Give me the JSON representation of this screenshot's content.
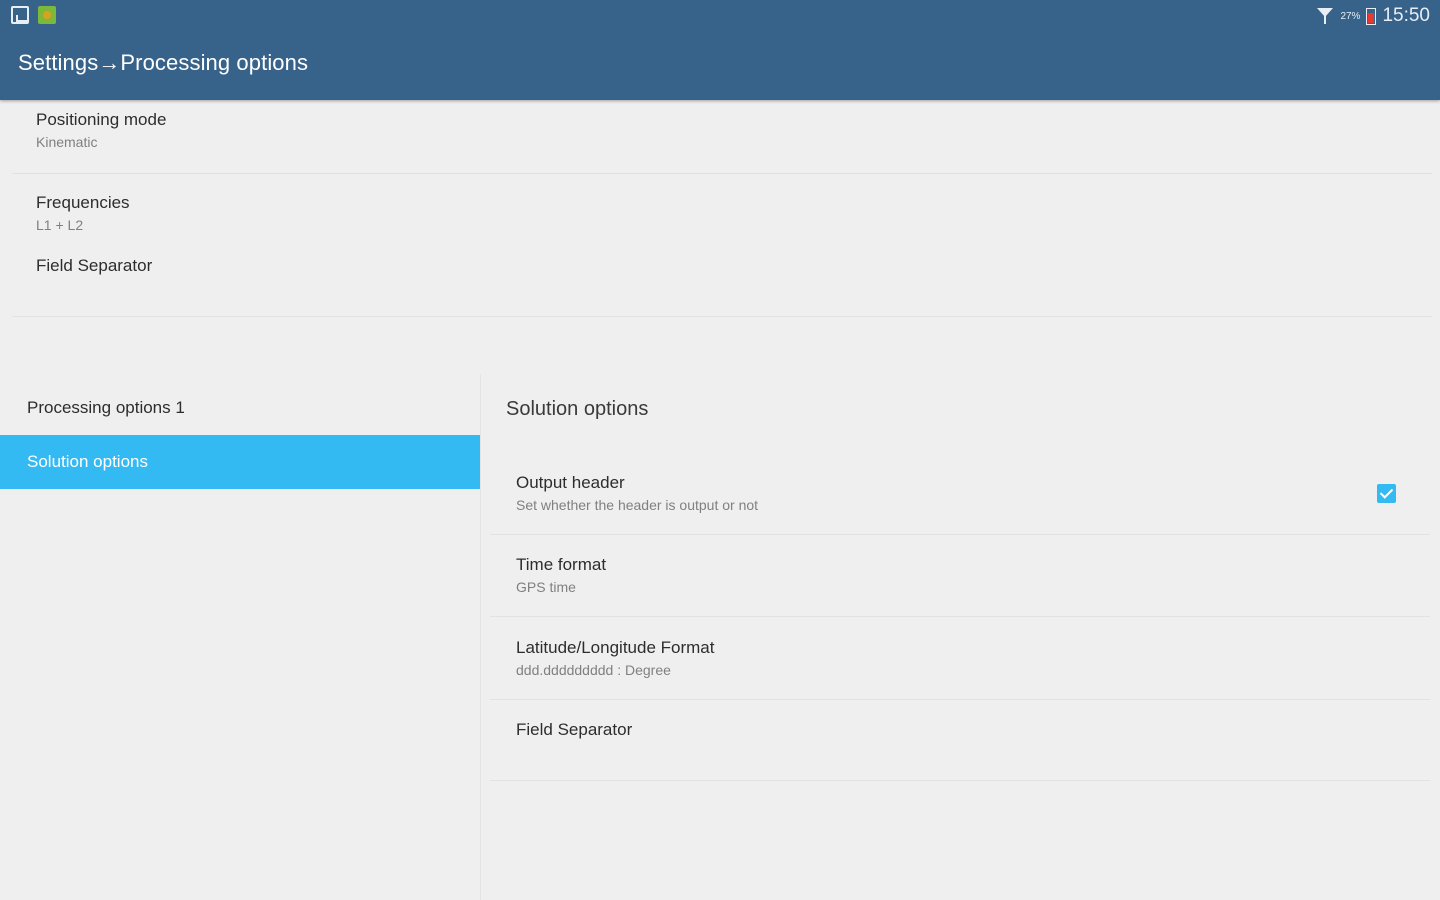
{
  "status_bar": {
    "battery": "27%",
    "time": "15:50",
    "icons": [
      "gallery-notification-icon",
      "app-notification-icon",
      "wifi-icon",
      "battery-icon"
    ]
  },
  "header": {
    "title": "Settings→Processing options"
  },
  "top_prefs": [
    {
      "title": "Positioning mode",
      "summary": "Kinematic"
    },
    {
      "title": "Frequencies",
      "summary": "L1 + L2"
    },
    {
      "title": "Field Separator",
      "summary": ""
    }
  ],
  "sidebar": {
    "items": [
      {
        "label": "Processing options 1",
        "selected": false
      },
      {
        "label": "Solution options",
        "selected": true
      }
    ]
  },
  "solution_options": {
    "title": "Solution options",
    "items": [
      {
        "title": "Output header",
        "summary": "Set whether the header is output or not",
        "checked": true
      },
      {
        "title": "Time format",
        "summary": "GPS time"
      },
      {
        "title": "Latitude/Longitude Format",
        "summary": "ddd.ddddddddd : Degree"
      },
      {
        "title": "Field Separator",
        "summary": ""
      }
    ]
  },
  "colors": {
    "header": "#37628a",
    "accent": "#33baf2",
    "background": "#efefef"
  }
}
